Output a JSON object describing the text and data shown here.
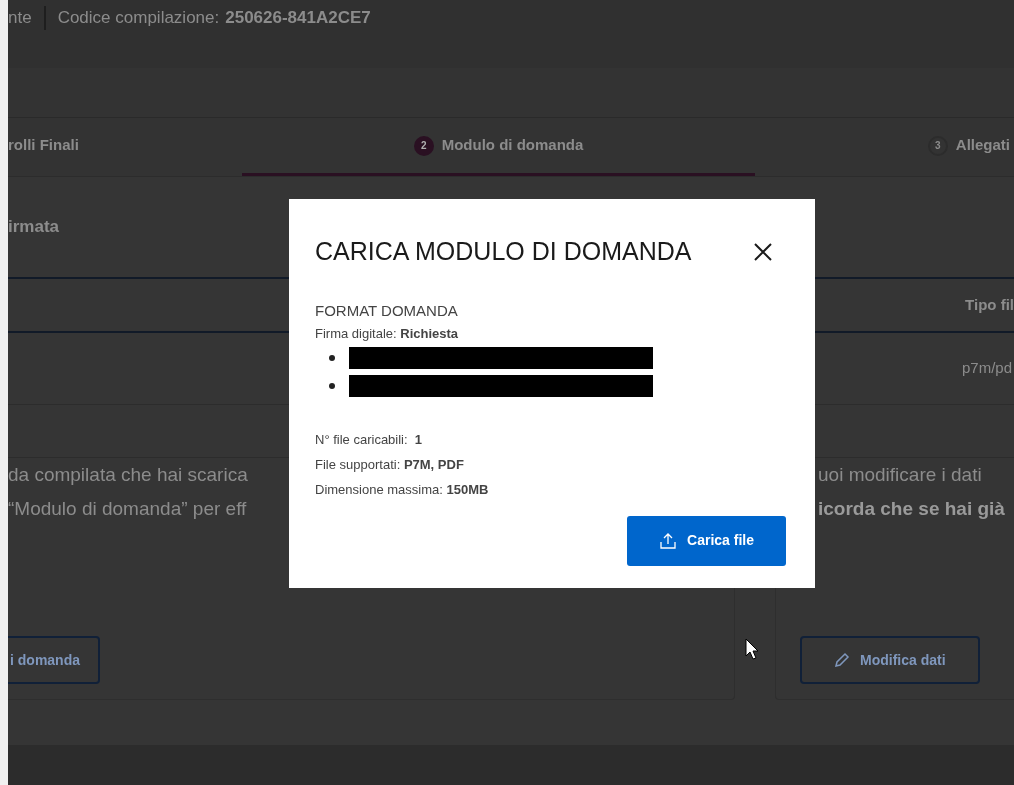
{
  "header": {
    "prefix": "nte",
    "label": "Codice compilazione:",
    "code": "250626-841A2CE7"
  },
  "steps": [
    {
      "label": "rolli Finali",
      "selected": false
    },
    {
      "number": "2",
      "label": "Modulo di domanda",
      "selected": true
    },
    {
      "number": "3",
      "label": "Allegati",
      "selected": false
    }
  ],
  "section_title": "irmata",
  "table": {
    "column_header": "Tipo fil",
    "cell": "p7m/pd"
  },
  "left_card": {
    "lines": [
      "da compilata che hai scarica",
      "“Modulo di domanda” per eff"
    ],
    "button": "i domanda"
  },
  "right_card": {
    "line": "uoi modificare i dati",
    "bold_line": "icorda che se hai già",
    "button": "Modifica dati"
  },
  "modal": {
    "title": "CARICA MODULO DI DOMANDA",
    "section": "FORMAT DOMANDA",
    "signature": "Firma digitale: **Richiesta**",
    "items": [
      {
        "kind": "redacted"
      },
      {
        "kind": "redacted"
      }
    ],
    "details": [
      "N° file caricabili:  **1**",
      "File supportati: **P7M, PDF**",
      "Dimensione massima: **150MB**"
    ],
    "button": "Carica file"
  }
}
